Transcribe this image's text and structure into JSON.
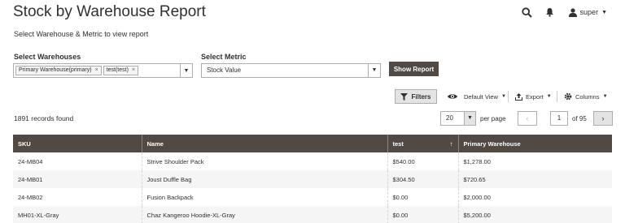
{
  "header": {
    "title": "Stock by Warehouse Report",
    "user": "super"
  },
  "subtitle": "Select Warehouse & Metric to view report",
  "filters": {
    "warehouses_label": "Select Warehouses",
    "warehouse_tags": [
      "Primary Warehouse(primary)",
      "test(test)"
    ],
    "metric_label": "Select Metric",
    "metric_value": "Stock Value",
    "show_report": "Show Report"
  },
  "toolbar": {
    "filters": "Filters",
    "view": "Default View",
    "export": "Export",
    "columns": "Columns"
  },
  "records": "1891 records found",
  "pagination": {
    "per_page_value": "20",
    "per_page_label": "per page",
    "current_page": "1",
    "of_label": "of 95"
  },
  "grid": {
    "columns": [
      "SKU",
      "Name",
      "test",
      "Primary Warehouse"
    ],
    "sorted_column": "test",
    "rows": [
      [
        "24-MB04",
        "Strive Shoulder Pack",
        "$540.00",
        "$1,278.00"
      ],
      [
        "24-MB01",
        "Joust Duffle Bag",
        "$304.50",
        "$720.65"
      ],
      [
        "24-MB02",
        "Fusion Backpack",
        "$0.00",
        "$2,000.00"
      ],
      [
        "MH01-XL-Gray",
        "Chaz Kangeroo Hoodie-XL-Gray",
        "$0.00",
        "$5,200.00"
      ]
    ]
  },
  "icons": {
    "search": "search-icon",
    "notifications": "bell-icon",
    "user": "user-icon",
    "filter": "funnel-icon",
    "view": "eye-icon",
    "export": "upload-icon",
    "columns": "gear-icon"
  }
}
